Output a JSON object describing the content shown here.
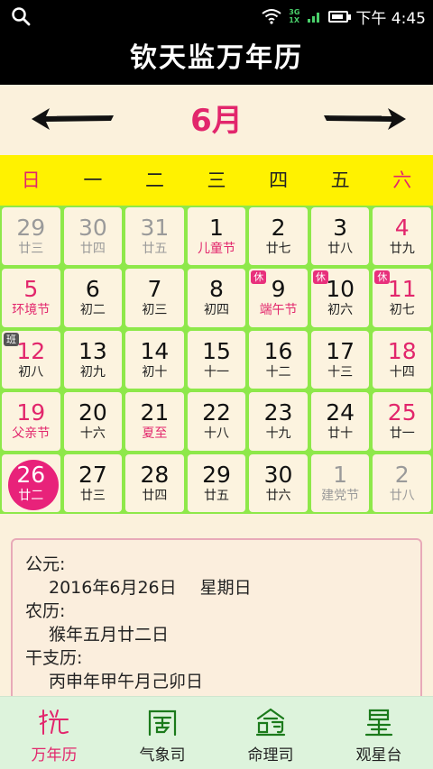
{
  "statusbar": {
    "network_top": "3G",
    "network_bottom": "1X",
    "time": "下午 4:45"
  },
  "app": {
    "title": "钦天监万年历"
  },
  "month": {
    "label": "6月"
  },
  "weekdays": [
    "日",
    "一",
    "二",
    "三",
    "四",
    "五",
    "六"
  ],
  "calendar": [
    [
      {
        "day": "29",
        "sub": "廿三",
        "style": "gray"
      },
      {
        "day": "30",
        "sub": "廿四",
        "style": "gray"
      },
      {
        "day": "31",
        "sub": "廿五",
        "style": "gray"
      },
      {
        "day": "1",
        "sub": "儿童节",
        "style": "holiday-text"
      },
      {
        "day": "2",
        "sub": "廿七",
        "style": "normal"
      },
      {
        "day": "3",
        "sub": "廿八",
        "style": "normal"
      },
      {
        "day": "4",
        "sub": "廿九",
        "style": "red"
      }
    ],
    [
      {
        "day": "5",
        "sub": "环境节",
        "style": "red-all"
      },
      {
        "day": "6",
        "sub": "初二",
        "style": "normal"
      },
      {
        "day": "7",
        "sub": "初三",
        "style": "normal"
      },
      {
        "day": "8",
        "sub": "初四",
        "style": "normal"
      },
      {
        "day": "9",
        "sub": "端午节",
        "style": "holiday-text",
        "badge": "休"
      },
      {
        "day": "10",
        "sub": "初六",
        "style": "normal",
        "badge": "休"
      },
      {
        "day": "11",
        "sub": "初七",
        "style": "red",
        "badge": "休"
      }
    ],
    [
      {
        "day": "12",
        "sub": "初八",
        "style": "red",
        "badge": "班"
      },
      {
        "day": "13",
        "sub": "初九",
        "style": "normal"
      },
      {
        "day": "14",
        "sub": "初十",
        "style": "normal"
      },
      {
        "day": "15",
        "sub": "十一",
        "style": "normal"
      },
      {
        "day": "16",
        "sub": "十二",
        "style": "normal"
      },
      {
        "day": "17",
        "sub": "十三",
        "style": "normal"
      },
      {
        "day": "18",
        "sub": "十四",
        "style": "red"
      }
    ],
    [
      {
        "day": "19",
        "sub": "父亲节",
        "style": "red-all"
      },
      {
        "day": "20",
        "sub": "十六",
        "style": "normal"
      },
      {
        "day": "21",
        "sub": "夏至",
        "style": "holiday-text"
      },
      {
        "day": "22",
        "sub": "十八",
        "style": "normal"
      },
      {
        "day": "23",
        "sub": "十九",
        "style": "normal"
      },
      {
        "day": "24",
        "sub": "廿十",
        "style": "normal"
      },
      {
        "day": "25",
        "sub": "廿一",
        "style": "red"
      }
    ],
    [
      {
        "day": "26",
        "sub": "廿二",
        "style": "today"
      },
      {
        "day": "27",
        "sub": "廿三",
        "style": "normal"
      },
      {
        "day": "28",
        "sub": "廿四",
        "style": "normal"
      },
      {
        "day": "29",
        "sub": "廿五",
        "style": "normal"
      },
      {
        "day": "30",
        "sub": "廿六",
        "style": "normal"
      },
      {
        "day": "1",
        "sub": "建党节",
        "style": "gray"
      },
      {
        "day": "2",
        "sub": "廿八",
        "style": "gray"
      }
    ]
  ],
  "info": {
    "gregorian_label": "公元:",
    "gregorian_date": "2016年6月26日",
    "weekday": "星期日",
    "lunar_label": "农历:",
    "lunar_date": "猴年五月廿二日",
    "ganzhi_label": "干支历:",
    "ganzhi_date": "丙申年甲午月己卯日"
  },
  "bottomnav": [
    {
      "label": "万年历",
      "icon": "calendar-seal-icon",
      "active": true
    },
    {
      "label": "气象司",
      "icon": "weather-seal-icon",
      "active": false
    },
    {
      "label": "命理司",
      "icon": "fortune-seal-icon",
      "active": false
    },
    {
      "label": "观星台",
      "icon": "star-seal-icon",
      "active": false
    }
  ],
  "colors": {
    "accent": "#e2266c",
    "weekbar": "#fff200",
    "grid": "#8ee84a",
    "cell": "#fcf3df",
    "nav": "#ddf3dc"
  }
}
